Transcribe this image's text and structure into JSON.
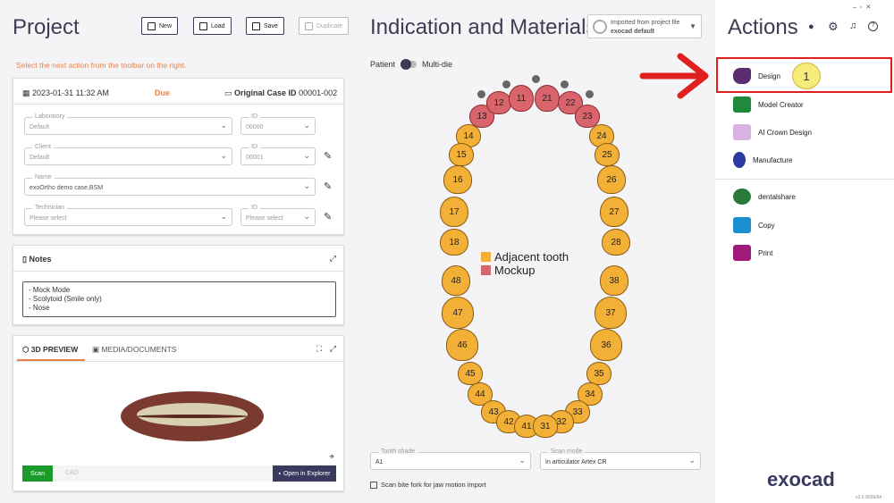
{
  "project": {
    "title": "Project",
    "buttons": {
      "new": "New",
      "load": "Load",
      "save": "Save",
      "duplicate": "Duplicate"
    },
    "hint": "Select the next action from the toolbar on the right."
  },
  "case": {
    "date": "2023-01-31 11:32 AM",
    "status": "Due",
    "case_id_label": "Original Case ID",
    "case_id": "00001-002",
    "laboratory": {
      "label": "Laboratory",
      "value": "Default"
    },
    "lab_id": {
      "label": "ID",
      "value": "00000"
    },
    "client": {
      "label": "Client",
      "value": "Default"
    },
    "client_id": {
      "label": "ID",
      "value": "00001"
    },
    "name": {
      "label": "Name",
      "value": "exoOrtho demo case,BSM"
    },
    "technician": {
      "label": "Technician",
      "value": "Please select"
    },
    "tech_id": {
      "label": "ID",
      "value": "Please select"
    }
  },
  "notes": {
    "title": "Notes",
    "lines": [
      "- Mock Mode",
      "- Scolytoid (Smile only)",
      "- Nose"
    ]
  },
  "preview": {
    "tab_3d": "3D PREVIEW",
    "tab_media": "MEDIA/DOCUMENTS",
    "scan": "Scan",
    "cad": "CAD",
    "open_explorer": "Open in Explorer"
  },
  "indication": {
    "title": "Indication and Materials",
    "imported_line1": "Imported from project file",
    "imported_line2": "exocad default",
    "patient": "Patient",
    "multidie": "Multi-die",
    "legend": [
      {
        "label": "Adjacent tooth",
        "color": "#f2b136"
      },
      {
        "label": "Mockup",
        "color": "#d9646c"
      }
    ],
    "tooth_shade": {
      "label": "Tooth shade",
      "value": "A1"
    },
    "scan_mode": {
      "label": "Scan mode",
      "value": "In articulator Artex CR"
    },
    "scan_bite": "Scan bite fork for jaw motion import",
    "teeth": [
      "13",
      "12",
      "11",
      "21",
      "22",
      "23",
      "14",
      "24",
      "15",
      "25",
      "16",
      "26",
      "17",
      "27",
      "18",
      "28",
      "48",
      "38",
      "47",
      "37",
      "46",
      "36",
      "45",
      "35",
      "44",
      "34",
      "43",
      "33",
      "42",
      "32",
      "41",
      "31"
    ],
    "mockup_teeth": [
      "13",
      "12",
      "11",
      "21",
      "22",
      "23"
    ]
  },
  "actions": {
    "title": "Actions",
    "items": [
      "Design",
      "Model Creator",
      "AI Crown Design",
      "Manufacture",
      "dentalshare",
      "Copy",
      "Print"
    ],
    "step": "1",
    "brand": "exocad",
    "version": "v3.2-9036/64"
  },
  "colors": {
    "accent": "#e8834a",
    "highlight": "#e02020"
  }
}
